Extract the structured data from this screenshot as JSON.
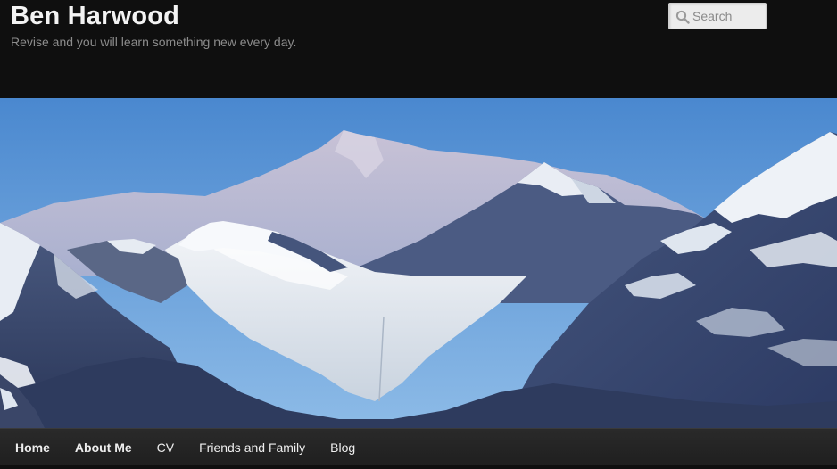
{
  "site": {
    "title": "Ben Harwood",
    "description": "Revise and you will learn something new every day."
  },
  "search": {
    "placeholder": "Search",
    "icon": "search-icon"
  },
  "header_image": {
    "subject": "mountain-glacier-panorama",
    "colors": {
      "sky_top": "#4a88cf",
      "sky_bottom": "#8dbbe7",
      "distant_peak": "#b9b8d4",
      "rock": "#3b4a70",
      "snow": "#f2f4f8",
      "glacier": "#dfe6ee"
    }
  },
  "nav": {
    "items": [
      {
        "label": "Home",
        "bold": true
      },
      {
        "label": "About Me",
        "bold": true
      },
      {
        "label": "CV",
        "bold": false
      },
      {
        "label": "Friends and Family",
        "bold": false
      },
      {
        "label": "Blog",
        "bold": false
      }
    ]
  },
  "colors": {
    "background": "#0d0d0d",
    "title": "#f3f3f3",
    "description": "#8c8c8c",
    "nav_bg": "#252525",
    "nav_text": "#eeeeee"
  }
}
